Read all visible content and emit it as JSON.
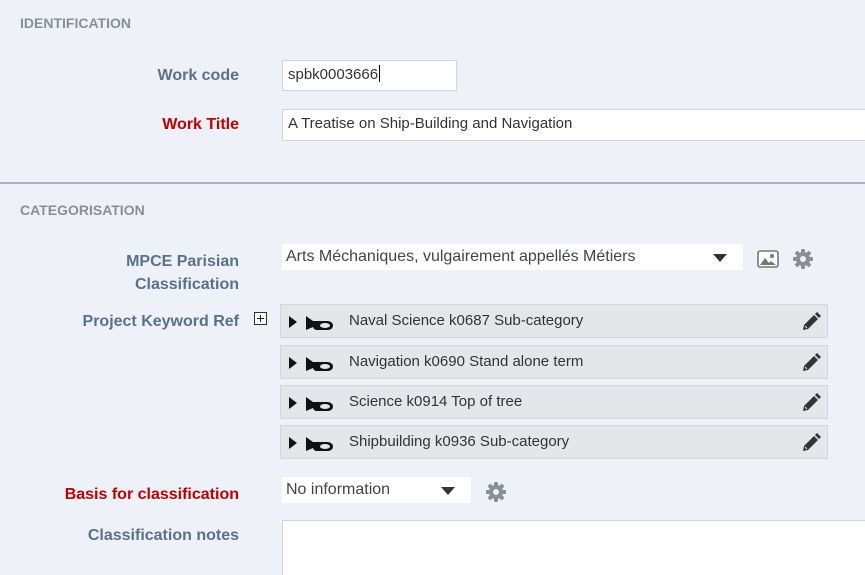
{
  "identification": {
    "title": "IDENTIFICATION",
    "work_code_label": "Work code",
    "work_code_value": "spbk0003666",
    "work_title_label": "Work Title",
    "work_title_value": "A Treatise on Ship-Building and Navigation"
  },
  "categorisation": {
    "title": "CATEGORISATION",
    "mpce_label_line1": "MPCE Parisian",
    "mpce_label_line2": "Classification",
    "mpce_value": "Arts Méchaniques, vulgairement appellés Métiers",
    "keyword_label": "Project Keyword Ref",
    "keywords": [
      {
        "label": "Naval Science k0687 Sub-category"
      },
      {
        "label": "Navigation k0690 Stand alone term"
      },
      {
        "label": "Science k0914 Top of tree"
      },
      {
        "label": "Shipbuilding k0936 Sub-category"
      }
    ],
    "basis_label": "Basis for classification",
    "basis_value": "No information",
    "notes_label": "Classification notes",
    "notes_value": ""
  },
  "icons": {
    "image": "image-icon",
    "settings": "gear-icon",
    "expand": "plus-box-icon",
    "disclosure": "triangle-right-icon",
    "keyword": "horn-icon",
    "edit": "pencil-icon"
  },
  "colors": {
    "background": "#eef2f8",
    "label": "#5c6f8c",
    "required_label": "#c00000",
    "section_title": "#8a8f96",
    "divider": "#a7b2c4"
  }
}
